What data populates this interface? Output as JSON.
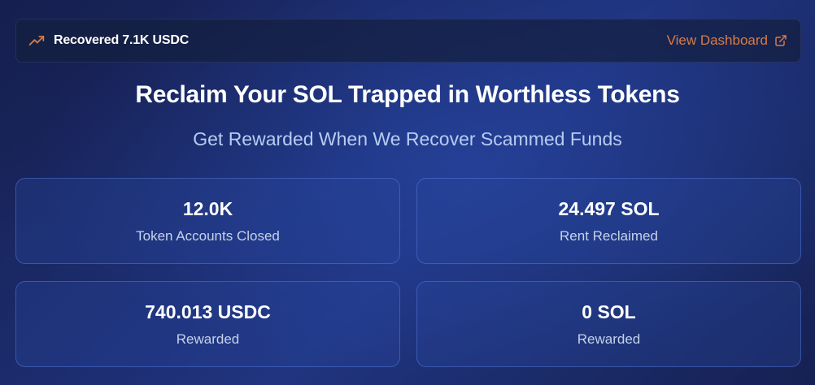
{
  "banner": {
    "recovered_text": "Recovered 7.1K USDC",
    "dashboard_link": "View Dashboard",
    "trend_icon": "trending-up-icon",
    "external_icon": "external-link-icon",
    "accent_color": "#d97b45"
  },
  "hero": {
    "title": "Reclaim Your SOL Trapped in Worthless Tokens",
    "subtitle": "Get Rewarded When We Recover Scammed Funds"
  },
  "stats": [
    {
      "value": "12.0K",
      "label": "Token Accounts Closed"
    },
    {
      "value": "24.497 SOL",
      "label": "Rent Reclaimed"
    },
    {
      "value": "740.013 USDC",
      "label": "Rewarded"
    },
    {
      "value": "0 SOL",
      "label": "Rewarded"
    }
  ]
}
